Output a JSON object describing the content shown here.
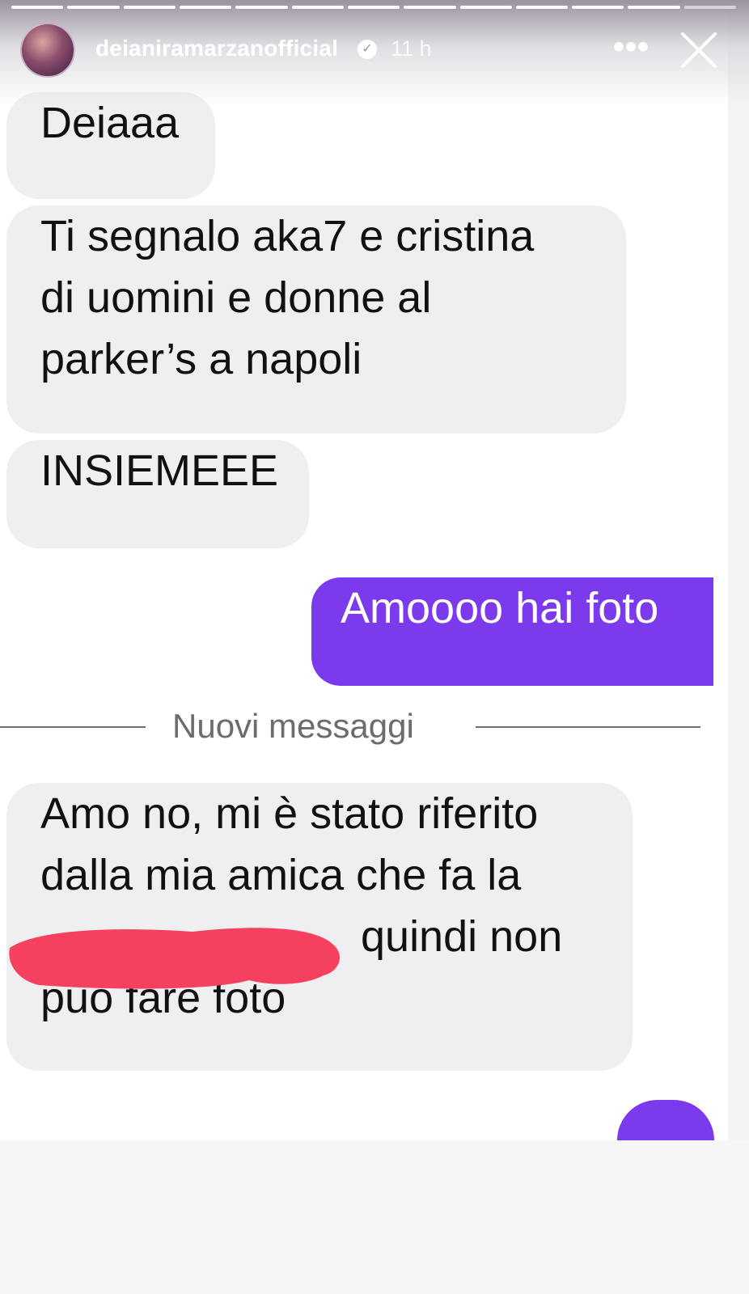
{
  "story": {
    "username": "deianiramarzanofficial",
    "timestamp": "11 h",
    "progress_segments": 13,
    "progress_done": 12
  },
  "icons": {
    "verified": "verified-badge-icon",
    "more": "more-options-icon",
    "close": "close-icon"
  },
  "colors": {
    "outgoing_bubble": "#7c3aed",
    "incoming_bubble": "#efeff2",
    "redaction": "#f5415f"
  },
  "messages": [
    {
      "direction": "in",
      "lines": [
        "Deiaaa"
      ]
    },
    {
      "direction": "in",
      "lines": [
        "Ti segnalo aka7 e cristina",
        "di uomini e donne al",
        "parker’s a napoli"
      ]
    },
    {
      "direction": "in",
      "lines": [
        "INSIEMEEE"
      ]
    },
    {
      "direction": "out",
      "lines": [
        "Amoooo hai foto"
      ]
    },
    {
      "direction": "in",
      "lines": [
        "Amo no, mi è stato riferito",
        "dalla mia amica che fa la",
        "quindi non",
        "puo fare foto"
      ]
    }
  ],
  "divider": {
    "label": "Nuovi messaggi"
  }
}
